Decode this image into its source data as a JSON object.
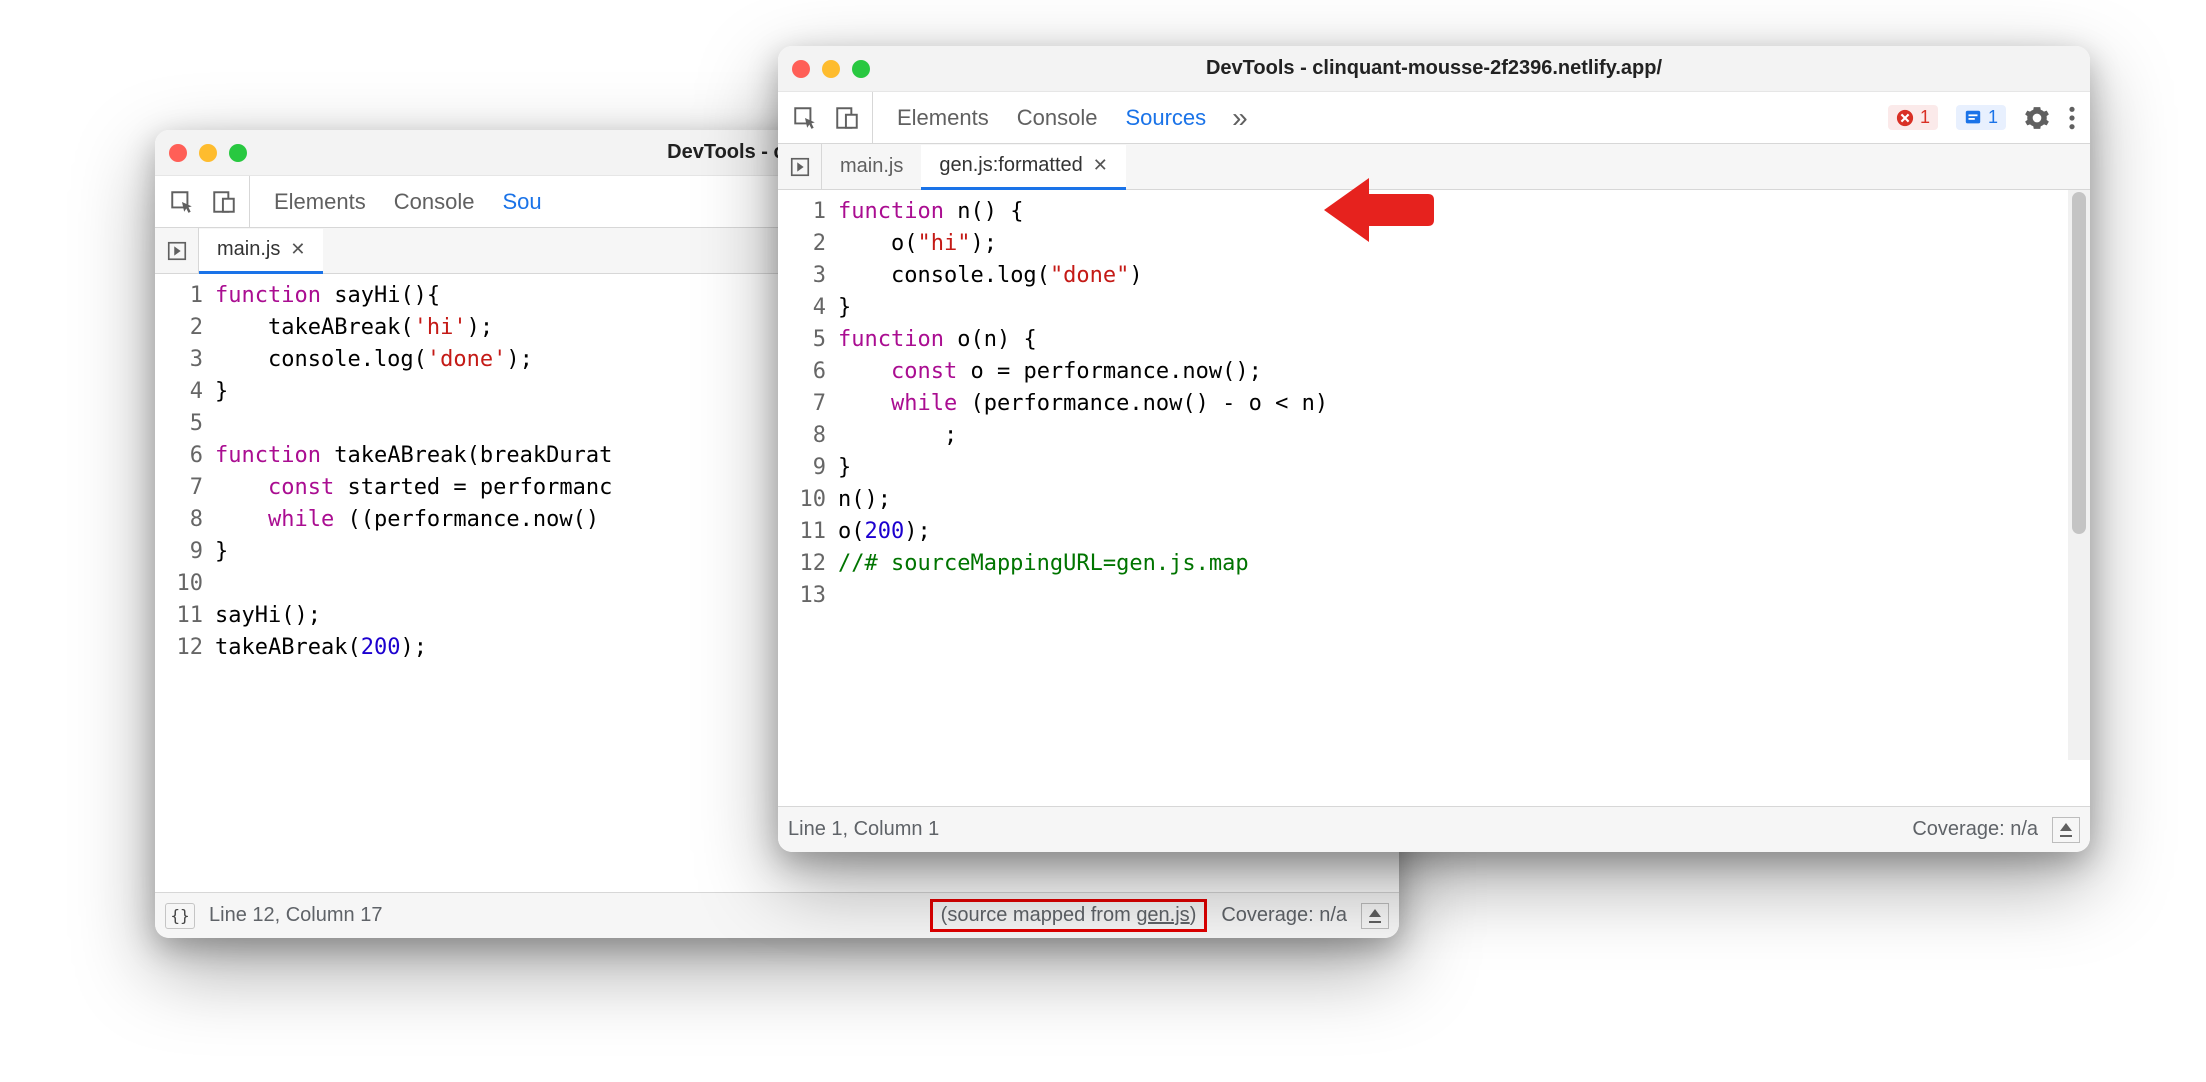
{
  "back": {
    "title": "DevTools - clinquant-m",
    "panels": {
      "elements": "Elements",
      "console": "Console",
      "sources": "Sou"
    },
    "tabs": [
      {
        "label": "main.js",
        "active": true
      }
    ],
    "gutter": [
      "1",
      "2",
      "3",
      "4",
      "5",
      "6",
      "7",
      "8",
      "9",
      "10",
      "11",
      "12"
    ],
    "status": {
      "line_col": "Line 12, Column 17",
      "source_mapped_prefix": "(source mapped from ",
      "source_mapped_file": "gen.js",
      "source_mapped_suffix": ")",
      "coverage": "Coverage: n/a"
    }
  },
  "front": {
    "title": "DevTools - clinquant-mousse-2f2396.netlify.app/",
    "panels": {
      "elements": "Elements",
      "console": "Console",
      "sources": "Sources"
    },
    "badges": {
      "errors": "1",
      "issues": "1"
    },
    "tabs": [
      {
        "label": "main.js",
        "active": false
      },
      {
        "label": "gen.js:formatted",
        "active": true
      }
    ],
    "gutter": [
      "1",
      "2",
      "3",
      "4",
      "5",
      "6",
      "7",
      "8",
      "9",
      "10",
      "11",
      "12",
      "13"
    ],
    "status": {
      "line_col": "Line 1, Column 1",
      "coverage": "Coverage: n/a"
    }
  },
  "code_back": {
    "l1": {
      "kw": "function",
      "rest": " sayHi(){"
    },
    "l2": "    takeABreak('hi');",
    "l3": "    console.log('done');",
    "l4": "}",
    "l5": "",
    "l6": {
      "kw": "function",
      "rest": " takeABreak(breakDurat"
    },
    "l7": {
      "kw": "const",
      "rest": " started = performanc"
    },
    "l8": {
      "kw": "while",
      "rest": " ((performance.now() "
    },
    "l9": "}",
    "l10": "",
    "l11": "sayHi();",
    "l12": {
      "pre": "takeABreak(",
      "num": "200",
      "post": ");"
    }
  },
  "code_front": {
    "l1": {
      "kw": "function",
      "rest": " n() {"
    },
    "l2": {
      "indent": "    ",
      "fn": "o(",
      "str": "\"hi\"",
      "post": ");"
    },
    "l3": {
      "indent": "    ",
      "fn": "console.log(",
      "str": "\"done\"",
      "post": ")"
    },
    "l4": "}",
    "l5": {
      "kw": "function",
      "rest": " o(n) {"
    },
    "l6": {
      "indent": "    ",
      "kw": "const",
      "rest": " o = performance.now();"
    },
    "l7": {
      "indent": "    ",
      "kw": "while",
      "rest": " (performance.now() - o < n)"
    },
    "l8": "        ;",
    "l9": "}",
    "l10": "n();",
    "l11": {
      "pre": "o(",
      "num": "200",
      "post": ");"
    },
    "l12": "//# sourceMappingURL=gen.js.map",
    "l13": ""
  }
}
